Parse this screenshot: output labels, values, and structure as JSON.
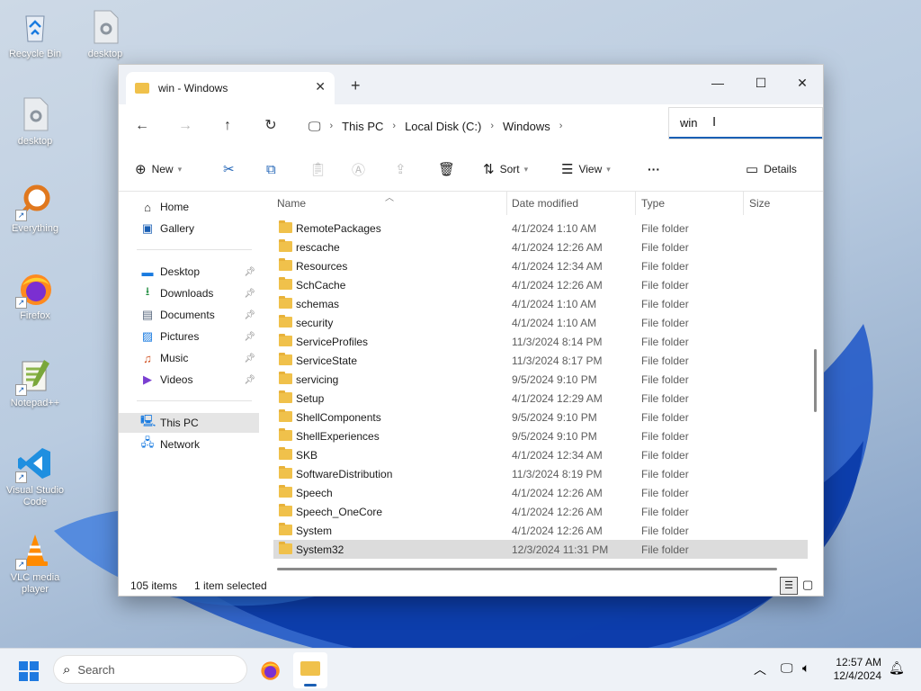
{
  "desktop": {
    "icons": [
      {
        "label": "Recycle Bin"
      },
      {
        "label": "desktop"
      },
      {
        "label": "desktop"
      },
      {
        "label": "Everything"
      },
      {
        "label": "Firefox"
      },
      {
        "label": "Notepad++"
      },
      {
        "label": "Visual Studio Code"
      },
      {
        "label": "VLC media player"
      }
    ]
  },
  "window": {
    "tab_title": "win - Windows",
    "close_tab_glyph": "✕",
    "new_tab_glyph": "+",
    "minimize_glyph": "—",
    "maximize_glyph": "☐",
    "close_glyph": "✕"
  },
  "address": {
    "crumbs": [
      "This PC",
      "Local Disk (C:)",
      "Windows"
    ],
    "search_value": "win"
  },
  "toolbar": {
    "new_label": "New",
    "sort_label": "Sort",
    "view_label": "View",
    "more_label": "···",
    "details_label": "Details"
  },
  "nav": {
    "home": "Home",
    "gallery": "Gallery",
    "desktop": "Desktop",
    "downloads": "Downloads",
    "documents": "Documents",
    "pictures": "Pictures",
    "music": "Music",
    "videos": "Videos",
    "this_pc": "This PC",
    "network": "Network"
  },
  "columns": {
    "name": "Name",
    "date": "Date modified",
    "type": "Type",
    "size": "Size"
  },
  "files": [
    {
      "name": "RemotePackages",
      "date": "4/1/2024 1:10 AM",
      "type": "File folder"
    },
    {
      "name": "rescache",
      "date": "4/1/2024 12:26 AM",
      "type": "File folder"
    },
    {
      "name": "Resources",
      "date": "4/1/2024 12:34 AM",
      "type": "File folder"
    },
    {
      "name": "SchCache",
      "date": "4/1/2024 12:26 AM",
      "type": "File folder"
    },
    {
      "name": "schemas",
      "date": "4/1/2024 1:10 AM",
      "type": "File folder"
    },
    {
      "name": "security",
      "date": "4/1/2024 1:10 AM",
      "type": "File folder"
    },
    {
      "name": "ServiceProfiles",
      "date": "11/3/2024 8:14 PM",
      "type": "File folder"
    },
    {
      "name": "ServiceState",
      "date": "11/3/2024 8:17 PM",
      "type": "File folder"
    },
    {
      "name": "servicing",
      "date": "9/5/2024 9:10 PM",
      "type": "File folder"
    },
    {
      "name": "Setup",
      "date": "4/1/2024 12:29 AM",
      "type": "File folder"
    },
    {
      "name": "ShellComponents",
      "date": "9/5/2024 9:10 PM",
      "type": "File folder"
    },
    {
      "name": "ShellExperiences",
      "date": "9/5/2024 9:10 PM",
      "type": "File folder"
    },
    {
      "name": "SKB",
      "date": "4/1/2024 12:34 AM",
      "type": "File folder"
    },
    {
      "name": "SoftwareDistribution",
      "date": "11/3/2024 8:19 PM",
      "type": "File folder"
    },
    {
      "name": "Speech",
      "date": "4/1/2024 12:26 AM",
      "type": "File folder"
    },
    {
      "name": "Speech_OneCore",
      "date": "4/1/2024 12:26 AM",
      "type": "File folder"
    },
    {
      "name": "System",
      "date": "4/1/2024 12:26 AM",
      "type": "File folder"
    },
    {
      "name": "System32",
      "date": "12/3/2024 11:31 PM",
      "type": "File folder"
    }
  ],
  "status": {
    "items": "105 items",
    "selected": "1 item selected"
  },
  "taskbar": {
    "search_label": "Search",
    "time": "12:57 AM",
    "date": "12/4/2024"
  },
  "colors": {
    "accent": "#1a5fb4",
    "folder": "#f0c14b",
    "selection": "#dcdcdc"
  }
}
